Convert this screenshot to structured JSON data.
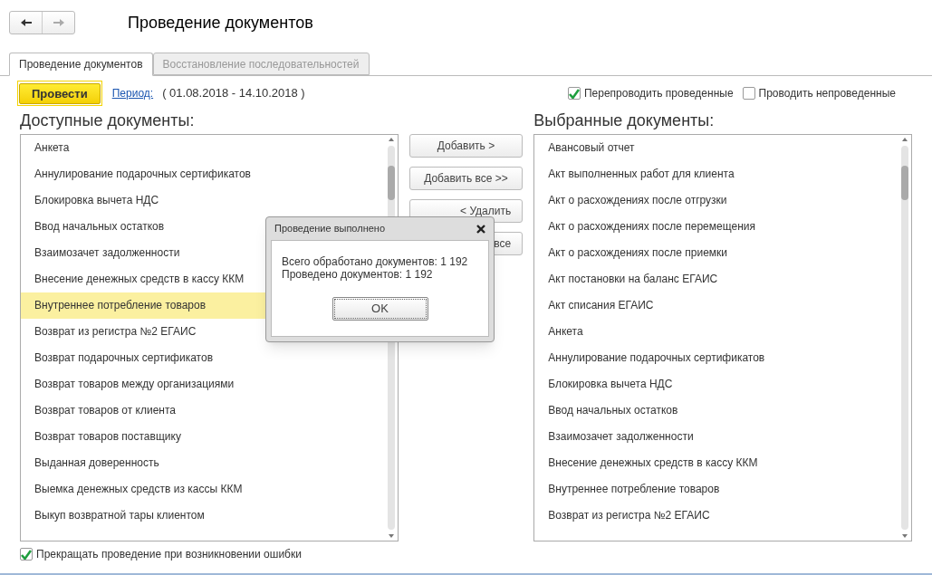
{
  "window": {
    "title": "Проведение документов",
    "nav": [
      {
        "kind": "back",
        "disabled": false
      },
      {
        "kind": "forward",
        "disabled": true
      }
    ]
  },
  "tabs": [
    {
      "label": "Проведение документов",
      "selected": true
    },
    {
      "label": "Восстановление последовательностей",
      "selected": false
    }
  ],
  "toolbar": {
    "post_button": "Провести",
    "period_link": "Период:",
    "period_value": "( 01.08.2018 - 14.10.2018 )",
    "options": [
      {
        "label": "Перепроводить проведенные",
        "checked": true
      },
      {
        "label": "Проводить непроведенные",
        "checked": false
      }
    ]
  },
  "available": {
    "title": "Доступные документы:",
    "items": [
      {
        "label": "Анкета",
        "selected": false
      },
      {
        "label": "Аннулирование подарочных сертификатов",
        "selected": false
      },
      {
        "label": "Блокировка вычета НДС",
        "selected": false
      },
      {
        "label": "Ввод начальных остатков",
        "selected": false
      },
      {
        "label": "Взаимозачет задолженности",
        "selected": false
      },
      {
        "label": "Внесение денежных средств в кассу ККМ",
        "selected": false
      },
      {
        "label": "Внутреннее потребление товаров",
        "selected": true
      },
      {
        "label": "Возврат из регистра №2 ЕГАИС",
        "selected": false
      },
      {
        "label": "Возврат подарочных сертификатов",
        "selected": false
      },
      {
        "label": "Возврат товаров между организациями",
        "selected": false
      },
      {
        "label": "Возврат товаров от клиента",
        "selected": false
      },
      {
        "label": "Возврат товаров поставщику",
        "selected": false
      },
      {
        "label": "Выданная доверенность",
        "selected": false
      },
      {
        "label": "Выемка денежных средств из кассы ККМ",
        "selected": false
      },
      {
        "label": "Выкуп возвратной тары клиентом",
        "selected": false
      }
    ]
  },
  "move_buttons": [
    "Добавить >",
    "Добавить все >>",
    "< Удалить",
    "все"
  ],
  "chosen": {
    "title": "Выбранные документы:",
    "items": [
      {
        "label": "Авансовый отчет",
        "selected": false
      },
      {
        "label": "Акт выполненных работ для клиента",
        "selected": false
      },
      {
        "label": "Акт о расхождениях после отгрузки",
        "selected": false
      },
      {
        "label": "Акт о расхождениях после перемещения",
        "selected": false
      },
      {
        "label": "Акт о расхождениях после приемки",
        "selected": false
      },
      {
        "label": "Акт постановки на баланс ЕГАИС",
        "selected": false
      },
      {
        "label": "Акт списания ЕГАИС",
        "selected": false
      },
      {
        "label": "Анкета",
        "selected": false
      },
      {
        "label": "Аннулирование подарочных сертификатов",
        "selected": false
      },
      {
        "label": "Блокировка вычета НДС",
        "selected": false
      },
      {
        "label": "Ввод начальных остатков",
        "selected": false
      },
      {
        "label": "Взаимозачет задолженности",
        "selected": false
      },
      {
        "label": "Внесение денежных средств в кассу ККМ",
        "selected": false
      },
      {
        "label": "Внутреннее потребление товаров",
        "selected": false
      },
      {
        "label": "Возврат из регистра №2 ЕГАИС",
        "selected": false
      }
    ]
  },
  "stop_on_error": {
    "label": "Прекращать проведение при возникновении ошибки",
    "checked": true
  },
  "dialog": {
    "title": "Проведение выполнено",
    "lines": [
      "Всего обработано документов: 1 192",
      "Проведено документов: 1 192"
    ],
    "button": "OK"
  }
}
